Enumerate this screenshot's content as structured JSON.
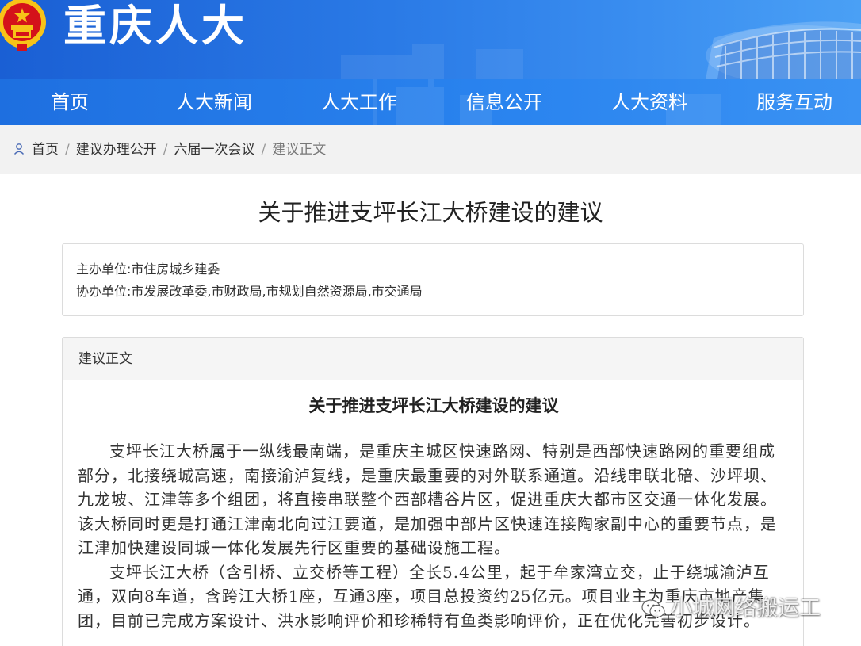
{
  "header": {
    "site_title": "重庆人大"
  },
  "nav": {
    "items": [
      "首页",
      "人大新闻",
      "人大工作",
      "信息公开",
      "人大资料",
      "服务互动"
    ]
  },
  "breadcrumb": {
    "items": [
      "首页",
      "建议办理公开",
      "六届一次会议"
    ],
    "current": "建议正文"
  },
  "page": {
    "title": "关于推进支坪长江大桥建设的建议"
  },
  "info": {
    "host_label": "主办单位:",
    "host_value": "市住房城乡建委",
    "assist_label": "协办单位:",
    "assist_value": "市发展改革委,市财政局,市规划自然资源局,市交通局"
  },
  "content": {
    "panel_title": "建议正文",
    "doc_title": "关于推进支坪长江大桥建设的建议",
    "paragraphs": [
      "支坪长江大桥属于一纵线最南端，是重庆主城区快速路网、特别是西部快速路网的重要组成部分，北接绕城高速，南接渝泸复线，是重庆最重要的对外联系通道。沿线串联北碚、沙坪坝、九龙坡、江津等多个组团，将直接串联整个西部槽谷片区，促进重庆大都市区交通一体化发展。该大桥同时更是打通江津南北向过江要道，是加强中部片区快速连接陶家副中心的重要节点，是江津加快建设同城一体化发展先行区重要的基础设施工程。",
      "支坪长江大桥（含引桥、立交桥等工程）全长5.4公里，起于牟家湾立交，止于绕城渝泸互通，双向8车道，含跨江大桥1座，互通3座，项目总投资约25亿元。项目业主为重庆市地产集团，目前已完成方案设计、洪水影响评价和珍稀特有鱼类影响评价，正在优化完善初步设计。"
    ]
  },
  "watermark": {
    "text": "小城网络搬运工"
  },
  "colors": {
    "banner_blue": "#2a7ae6",
    "emblem_red": "#d4121a",
    "emblem_gold": "#f7c318"
  },
  "icons": {
    "breadcrumb_home": "user-icon",
    "emblem": "national-emblem-icon",
    "watermark": "wechat-icon"
  }
}
